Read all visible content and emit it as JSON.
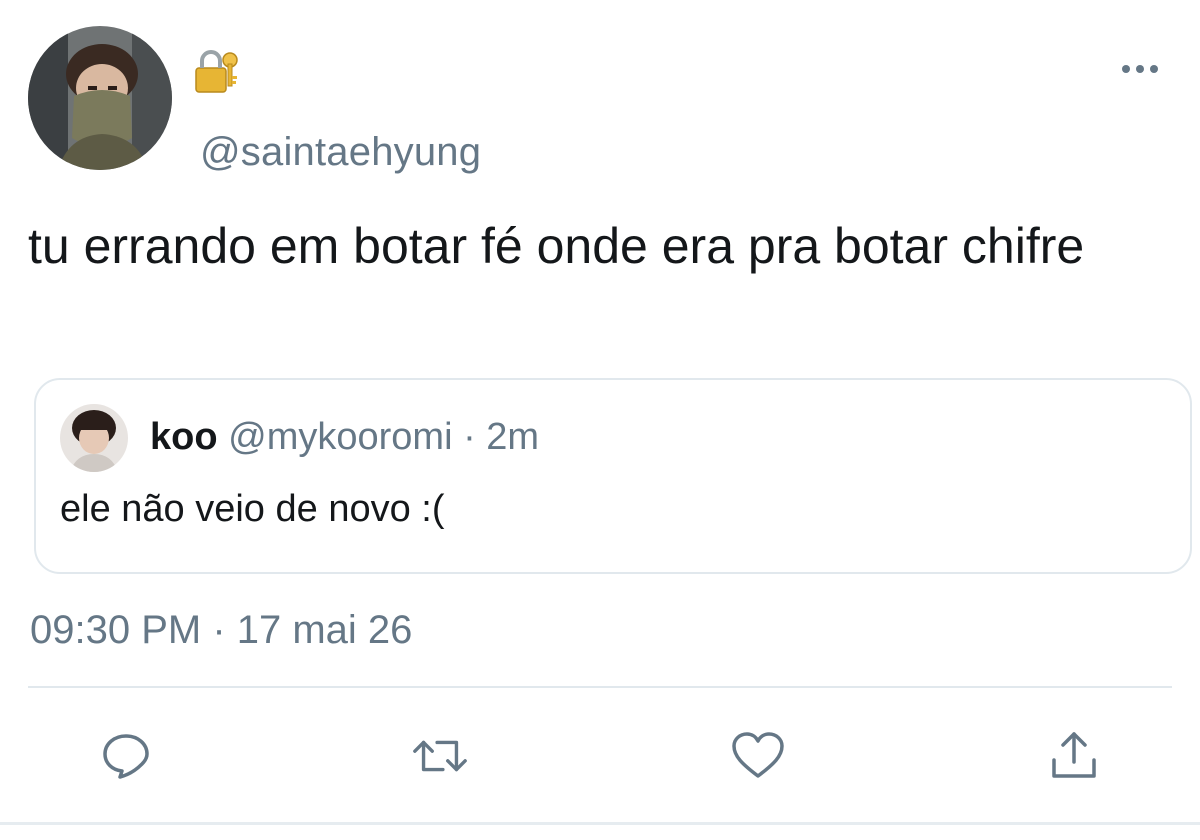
{
  "author": {
    "handle": "@saintaehyung",
    "avatar_icon": "profile-photo",
    "protected_icon": "lock-icon"
  },
  "tweet": {
    "text": "tu errando em botar fé onde era pra botar chifre",
    "timestamp": "09:30 PM · 17 mai 26"
  },
  "quoted_tweet": {
    "name": "koo",
    "handle": "@mykooromi",
    "separator": "·",
    "time": "2m",
    "text": "ele não veio de novo :("
  },
  "actions": {
    "reply_icon": "reply-icon",
    "retweet_icon": "retweet-icon",
    "like_icon": "heart-icon",
    "share_icon": "share-icon",
    "more_icon": "more-icon"
  },
  "colors": {
    "text": "#14171a",
    "secondary": "#657786",
    "border": "#e1e8ed",
    "icon": "#657786",
    "lock_gold": "#e7b534"
  }
}
